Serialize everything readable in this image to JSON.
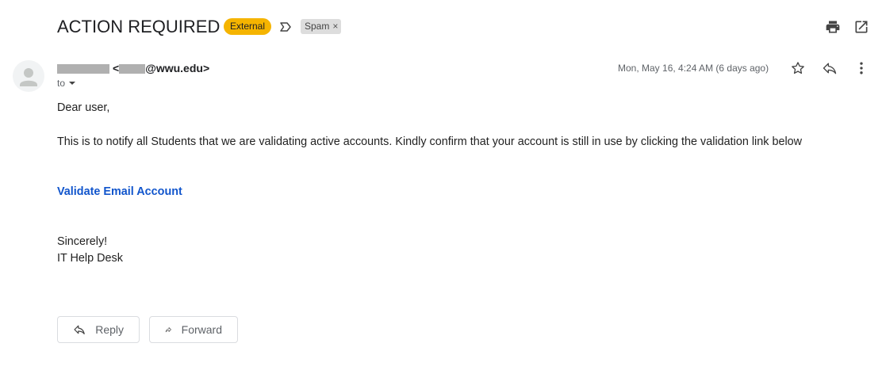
{
  "header": {
    "subject": "ACTION REQUIRED !",
    "external_badge": "External",
    "spam_label": "Spam",
    "spam_remove": "×",
    "icons": {
      "label": "label-important-outline-icon",
      "print": "print-icon",
      "popout": "open-in-new-window-icon"
    }
  },
  "sender": {
    "open_bracket": "<",
    "email_domain": "@wwu.edu>",
    "to_label": "to",
    "date": "Mon, May 16, 4:24 AM (6 days ago)",
    "icons": {
      "avatar": "default-avatar-icon",
      "star": "star-outline-icon",
      "reply": "reply-icon",
      "more": "more-vertical-icon",
      "to_dropdown": "caret-down-icon"
    }
  },
  "message": {
    "greeting": "Dear user,",
    "paragraph": "This is to notify all Students that we are validating active accounts. Kindly confirm that your account is still in use by clicking the validation link below",
    "link_text": "Validate Email Account",
    "closing": "Sincerely!",
    "signature": "IT Help Desk"
  },
  "actions": {
    "reply_label": "Reply",
    "forward_label": "Forward"
  },
  "colors": {
    "external_badge": "#f5b400",
    "spam_badge": "#dddddd",
    "link": "#1155cc",
    "icon_gray": "#5f6368"
  }
}
